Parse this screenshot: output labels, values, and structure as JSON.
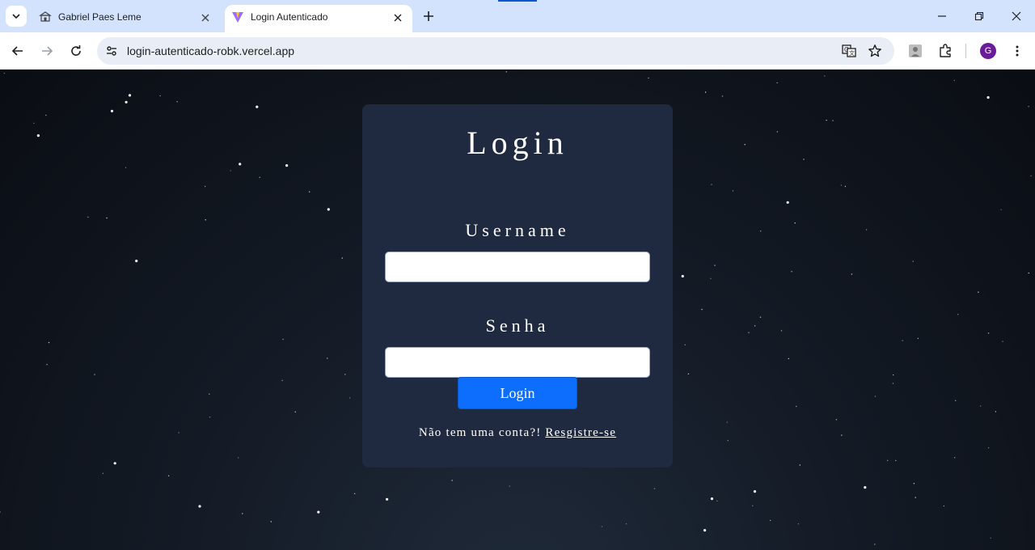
{
  "browser": {
    "tabs": [
      {
        "title": "Gabriel Paes Leme",
        "icon": "bank-icon",
        "active": false
      },
      {
        "title": "Login Autenticado",
        "icon": "vite-logo-icon",
        "active": true
      }
    ],
    "url": "login-autenticado-robk.vercel.app",
    "avatar_initial": "G",
    "accent_color": "#0b57d0"
  },
  "login": {
    "title": "Login",
    "username_label": "Username",
    "username_value": "",
    "password_label": "Senha",
    "password_value": "",
    "submit_label": "Login",
    "signup_prompt": "Não tem uma conta?!",
    "signup_link": "Resgistre-se",
    "button_color": "#0d6efd",
    "card_color": "#1f2a40"
  }
}
